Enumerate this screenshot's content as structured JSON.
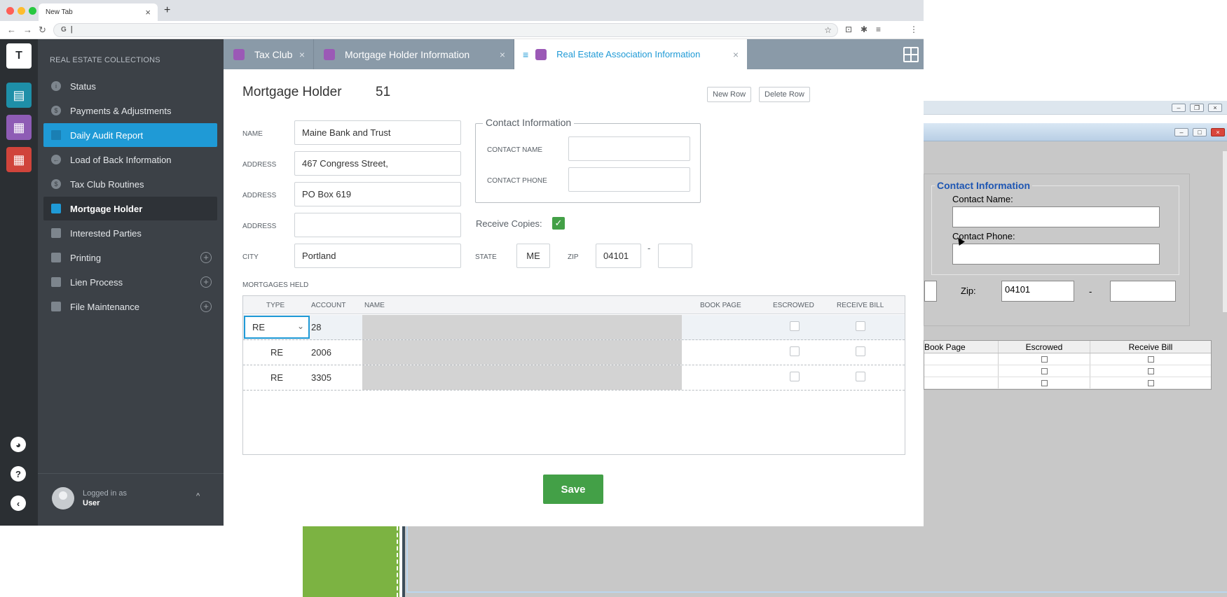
{
  "browser": {
    "tab_title": "New Tab",
    "tab_close": "×",
    "new_tab": "+",
    "omnibox_value": "|",
    "omnibox_g": "G"
  },
  "sidebar": {
    "heading": "REAL ESTATE COLLECTIONS",
    "items": [
      {
        "label": "Status"
      },
      {
        "label": "Payments & Adjustments"
      },
      {
        "label": "Daily Audit Report"
      },
      {
        "label": "Load of Back Information"
      },
      {
        "label": "Tax Club Routines"
      },
      {
        "label": "Mortgage Holder"
      },
      {
        "label": "Interested Parties"
      },
      {
        "label": "Printing"
      },
      {
        "label": "Lien Process"
      },
      {
        "label": "File Maintenance"
      }
    ],
    "rail_logo": "T",
    "user": {
      "logged_in_label": "Logged in as",
      "name": "User",
      "chevron": "^"
    }
  },
  "tabs": [
    {
      "label": "Tax Club"
    },
    {
      "label": "Mortgage Holder Information"
    },
    {
      "label": "Real Estate Association Information"
    }
  ],
  "form": {
    "title": "Mortgage Holder",
    "record_number": "51",
    "new_row": "New Row",
    "delete_row": "Delete Row",
    "name_label": "NAME",
    "name_value": "Maine Bank and Trust",
    "address_label": "ADDRESS",
    "address1_value": "467 Congress Street,",
    "address2_value": "PO Box 619",
    "address3_value": "",
    "city_label": "CITY",
    "city_value": "Portland",
    "state_label": "STATE",
    "state_value": "ME",
    "zip_label": "ZIP",
    "zip_value": "04101",
    "zip_dash": "-",
    "zip_ext_value": "",
    "contact_legend": "Contact Information",
    "contact_name_label": "CONTACT NAME",
    "contact_name_value": "",
    "contact_phone_label": "CONTACT PHONE",
    "contact_phone_value": "",
    "receive_copies_label": "Receive Copies:",
    "receive_copies_checked": true,
    "mortgages_held_label": "MORTGAGES HELD",
    "columns": [
      "TYPE",
      "ACCOUNT",
      "NAME",
      "BOOK PAGE",
      "ESCROWED",
      "RECEIVE BILL"
    ],
    "rows": [
      {
        "type": "RE",
        "account": "28"
      },
      {
        "type": "RE",
        "account": "2006"
      },
      {
        "type": "RE",
        "account": "3305"
      }
    ],
    "save": "Save"
  },
  "legacy": {
    "contact_legend": "Contact Information",
    "contact_name_label": "Contact Name:",
    "contact_phone_label": "Contact Phone:",
    "zip_label": "Zip:",
    "zip_value": "04101",
    "zip_dash": "-",
    "columns": [
      "Book Page",
      "Escrowed",
      "Receive Bill"
    ]
  },
  "colors": {
    "accent": "#1f9ad6",
    "save_green": "#43a047",
    "sidebar_bg": "#3c4147",
    "tabbar_bg": "#8a9aa8"
  }
}
